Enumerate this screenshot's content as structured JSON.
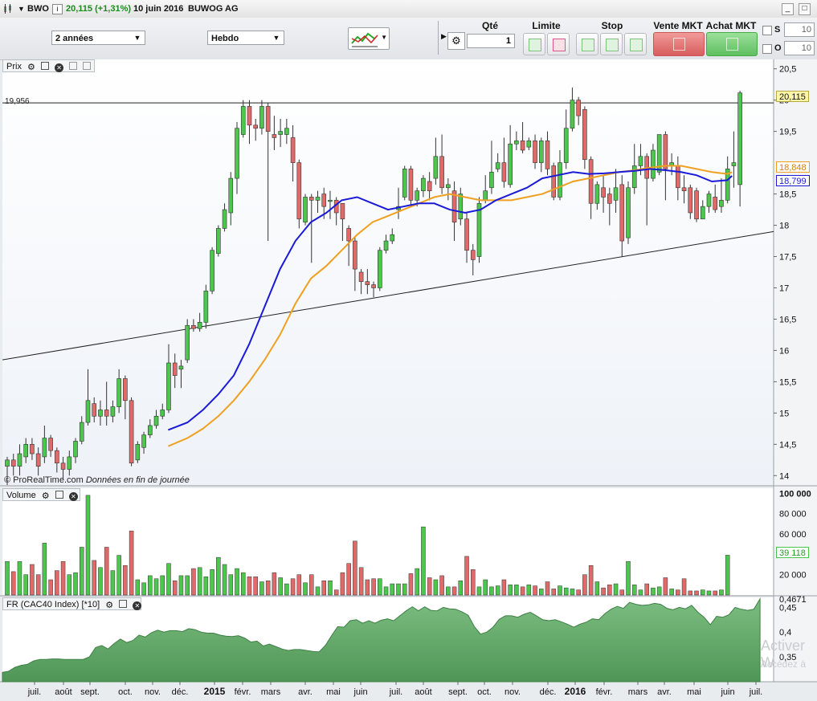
{
  "titlebar": {
    "symbol": "BWO",
    "last": "20,115 (+1,31%)",
    "date": "10 juin 2016",
    "name": "BUWOG AG",
    "min_btn": "_",
    "close_btn": "□"
  },
  "toolbar": {
    "period": "2 années",
    "frequency": "Hebdo",
    "qte_label": "Qté",
    "qte_value": "1",
    "limite_label": "Limite",
    "stop_label": "Stop",
    "vente_label": "Vente MKT",
    "achat_label": "Achat MKT",
    "s_label": "S",
    "s_value": "10",
    "o_label": "O",
    "o_value": "10"
  },
  "panes": {
    "price_label": "Prix",
    "volume_label": "Volume",
    "cac_label": "FR (CAC40 Index) [*10]",
    "credit": "© ProRealTime.com",
    "credit_note": "Données en fin de journée",
    "ref_level": "19,956",
    "watermark": "Activer W",
    "watermark2": "Accédez à"
  },
  "price_axis": {
    "ticks": [
      "20,5",
      "20",
      "19,5",
      "18,5",
      "18",
      "17,5",
      "17",
      "16,5",
      "16",
      "15,5",
      "15",
      "14,5",
      "14"
    ],
    "badge_last": "20,115",
    "badge_ma_orange": "18,848",
    "badge_ma_blue": "18,799"
  },
  "volume_axis": {
    "ticks": [
      "100 000",
      "80 000",
      "60 000",
      "20 000"
    ],
    "badge_last": "39 118"
  },
  "cac_axis": {
    "ticks": [
      "0,4671",
      "0,45",
      "0,4",
      "0,35"
    ]
  },
  "time_axis": {
    "labels": [
      "juil.",
      "août",
      "sept.",
      "oct.",
      "nov.",
      "déc.",
      "2015",
      "févr.",
      "mars",
      "avr.",
      "mai",
      "juin",
      "juil.",
      "août",
      "sept.",
      "oct.",
      "nov.",
      "déc.",
      "2016",
      "févr.",
      "mars",
      "avr.",
      "mai",
      "juin",
      "juil."
    ]
  },
  "colors": {
    "up": "#4cc64c",
    "down": "#e06a6a",
    "ma_blue": "#1a1ad8",
    "ma_orange": "#f0a020",
    "cac_fill": "#6fae75"
  },
  "chart_data": {
    "type": "candlestick",
    "frequency": "weekly",
    "y_range": [
      13.85,
      20.65
    ],
    "reference_level": 19.956,
    "ohlc": [
      [
        14.15,
        14.25,
        13.85,
        14.3
      ],
      [
        14.25,
        14.15,
        14.0,
        14.35
      ],
      [
        14.15,
        14.35,
        14.0,
        14.5
      ],
      [
        14.3,
        14.5,
        14.2,
        14.6
      ],
      [
        14.5,
        14.35,
        14.25,
        14.6
      ],
      [
        14.35,
        14.15,
        14.0,
        14.45
      ],
      [
        14.3,
        14.6,
        14.2,
        14.8
      ],
      [
        14.6,
        14.4,
        14.3,
        14.65
      ],
      [
        14.4,
        14.2,
        14.05,
        14.45
      ],
      [
        14.2,
        14.1,
        13.95,
        14.3
      ],
      [
        14.1,
        14.3,
        14.0,
        14.4
      ],
      [
        14.3,
        14.55,
        14.2,
        14.6
      ],
      [
        14.55,
        14.85,
        14.5,
        14.95
      ],
      [
        14.85,
        15.2,
        14.8,
        15.7
      ],
      [
        15.15,
        14.95,
        14.85,
        15.25
      ],
      [
        14.95,
        15.05,
        14.8,
        15.2
      ],
      [
        15.05,
        14.95,
        14.8,
        15.5
      ],
      [
        14.95,
        15.1,
        14.85,
        15.2
      ],
      [
        15.1,
        15.55,
        15.0,
        15.7
      ],
      [
        15.55,
        15.2,
        14.9,
        15.6
      ],
      [
        15.2,
        14.2,
        14.15,
        15.25
      ],
      [
        14.25,
        14.5,
        14.2,
        14.55
      ],
      [
        14.45,
        14.65,
        14.35,
        14.7
      ],
      [
        14.65,
        14.8,
        14.6,
        14.9
      ],
      [
        14.8,
        14.95,
        14.75,
        15.05
      ],
      [
        14.95,
        15.05,
        14.9,
        15.15
      ],
      [
        15.05,
        15.8,
        15.0,
        16.1
      ],
      [
        15.8,
        15.6,
        15.4,
        15.95
      ],
      [
        15.7,
        15.75,
        15.4,
        15.85
      ],
      [
        15.85,
        16.4,
        15.8,
        16.5
      ],
      [
        16.4,
        16.35,
        16.3,
        16.5
      ],
      [
        16.35,
        16.45,
        16.3,
        16.6
      ],
      [
        16.45,
        16.95,
        16.35,
        17.05
      ],
      [
        16.95,
        17.6,
        16.9,
        17.65
      ],
      [
        17.55,
        17.95,
        17.5,
        18.0
      ],
      [
        17.95,
        18.25,
        17.9,
        18.35
      ],
      [
        18.2,
        18.75,
        18.0,
        18.85
      ],
      [
        18.75,
        19.55,
        18.5,
        19.65
      ],
      [
        19.45,
        19.9,
        19.4,
        20.0
      ],
      [
        19.9,
        19.6,
        19.3,
        20.0
      ],
      [
        19.6,
        19.55,
        19.35,
        19.7
      ],
      [
        19.55,
        19.9,
        19.45,
        20.0
      ],
      [
        19.9,
        19.5,
        17.75,
        19.95
      ],
      [
        19.45,
        19.4,
        19.2,
        19.75
      ],
      [
        19.45,
        19.5,
        19.25,
        19.7
      ],
      [
        19.45,
        19.55,
        19.3,
        19.7
      ],
      [
        19.4,
        19.0,
        18.7,
        19.6
      ],
      [
        19.0,
        18.1,
        17.95,
        19.05
      ],
      [
        18.05,
        18.45,
        18.0,
        18.5
      ],
      [
        18.45,
        18.4,
        17.4,
        18.5
      ],
      [
        18.4,
        18.45,
        18.2,
        18.55
      ],
      [
        18.5,
        18.3,
        18.1,
        18.6
      ],
      [
        18.4,
        18.4,
        18.1,
        18.55
      ],
      [
        18.4,
        18.2,
        18.0,
        18.45
      ],
      [
        18.35,
        18.1,
        17.75,
        18.35
      ],
      [
        17.95,
        17.75,
        17.35,
        18.0
      ],
      [
        17.75,
        17.3,
        16.95,
        17.8
      ],
      [
        17.25,
        17.1,
        16.9,
        17.3
      ],
      [
        17.1,
        17.05,
        16.9,
        17.3
      ],
      [
        17.05,
        17.0,
        16.85,
        17.1
      ],
      [
        17.0,
        17.6,
        16.95,
        17.65
      ],
      [
        17.6,
        17.75,
        17.55,
        17.85
      ],
      [
        17.75,
        17.85,
        17.7,
        17.95
      ],
      [
        18.25,
        18.3,
        18.1,
        18.6
      ],
      [
        18.45,
        18.9,
        18.4,
        18.95
      ],
      [
        18.9,
        18.4,
        18.3,
        18.95
      ],
      [
        18.4,
        18.55,
        18.3,
        18.6
      ],
      [
        18.55,
        18.75,
        18.45,
        18.8
      ],
      [
        18.7,
        18.55,
        18.4,
        18.85
      ],
      [
        18.75,
        19.1,
        18.65,
        19.4
      ],
      [
        19.1,
        18.6,
        18.5,
        19.45
      ],
      [
        18.6,
        18.65,
        18.4,
        18.75
      ],
      [
        18.55,
        18.05,
        17.75,
        18.7
      ],
      [
        18.1,
        18.5,
        18.0,
        18.6
      ],
      [
        18.1,
        17.6,
        17.4,
        18.2
      ],
      [
        17.6,
        17.45,
        17.2,
        17.7
      ],
      [
        17.5,
        18.35,
        17.4,
        18.45
      ],
      [
        18.4,
        18.55,
        18.35,
        18.8
      ],
      [
        18.6,
        18.85,
        18.5,
        19.35
      ],
      [
        18.9,
        19.0,
        18.85,
        19.15
      ],
      [
        19.0,
        18.7,
        18.6,
        19.4
      ],
      [
        18.65,
        19.3,
        18.6,
        19.6
      ],
      [
        19.3,
        19.35,
        19.2,
        19.5
      ],
      [
        19.35,
        19.2,
        19.15,
        19.65
      ],
      [
        19.25,
        19.35,
        19.2,
        19.4
      ],
      [
        19.35,
        19.0,
        18.9,
        19.45
      ],
      [
        19.0,
        19.35,
        18.85,
        19.4
      ],
      [
        19.35,
        18.9,
        18.8,
        19.5
      ],
      [
        18.95,
        18.45,
        18.4,
        19.0
      ],
      [
        18.45,
        19.0,
        18.4,
        19.2
      ],
      [
        19.0,
        19.55,
        18.9,
        19.85
      ],
      [
        19.55,
        20.0,
        19.5,
        20.2
      ],
      [
        20.0,
        19.75,
        19.6,
        20.05
      ],
      [
        19.85,
        19.05,
        18.9,
        19.9
      ],
      [
        19.05,
        18.35,
        18.1,
        19.1
      ],
      [
        18.35,
        18.65,
        18.25,
        18.7
      ],
      [
        18.6,
        18.45,
        18.2,
        18.8
      ],
      [
        18.5,
        18.35,
        18.0,
        18.6
      ],
      [
        18.4,
        18.6,
        18.2,
        18.9
      ],
      [
        18.65,
        17.75,
        17.5,
        18.8
      ],
      [
        17.8,
        18.6,
        17.7,
        18.7
      ],
      [
        18.6,
        18.95,
        18.5,
        19.3
      ],
      [
        18.95,
        19.1,
        18.8,
        19.3
      ],
      [
        19.1,
        18.75,
        18.0,
        19.15
      ],
      [
        18.75,
        19.2,
        18.7,
        19.3
      ],
      [
        18.85,
        19.45,
        18.8,
        19.45
      ],
      [
        19.45,
        18.9,
        18.4,
        19.5
      ],
      [
        18.95,
        19.0,
        18.8,
        19.15
      ],
      [
        18.95,
        18.6,
        18.4,
        19.1
      ],
      [
        18.6,
        18.55,
        18.35,
        18.8
      ],
      [
        18.6,
        18.2,
        18.1,
        18.65
      ],
      [
        18.55,
        18.1,
        18.05,
        18.6
      ],
      [
        18.1,
        18.3,
        18.1,
        18.4
      ],
      [
        18.3,
        18.5,
        18.2,
        18.55
      ],
      [
        18.45,
        18.25,
        18.2,
        18.65
      ],
      [
        18.3,
        18.4,
        18.2,
        18.75
      ],
      [
        18.4,
        18.9,
        18.35,
        19.1
      ],
      [
        18.95,
        19.0,
        18.6,
        19.5
      ],
      [
        18.65,
        20.115,
        18.3,
        20.15
      ]
    ],
    "ma_blue": [
      [
        0.215,
        14.73
      ],
      [
        0.24,
        14.85
      ],
      [
        0.26,
        15.05
      ],
      [
        0.28,
        15.3
      ],
      [
        0.3,
        15.6
      ],
      [
        0.32,
        16.1
      ],
      [
        0.34,
        16.7
      ],
      [
        0.36,
        17.3
      ],
      [
        0.38,
        17.75
      ],
      [
        0.4,
        18.05
      ],
      [
        0.42,
        18.2
      ],
      [
        0.44,
        18.4
      ],
      [
        0.46,
        18.45
      ],
      [
        0.48,
        18.35
      ],
      [
        0.5,
        18.25
      ],
      [
        0.52,
        18.3
      ],
      [
        0.54,
        18.35
      ],
      [
        0.56,
        18.35
      ],
      [
        0.58,
        18.25
      ],
      [
        0.6,
        18.2
      ],
      [
        0.62,
        18.25
      ],
      [
        0.64,
        18.4
      ],
      [
        0.66,
        18.5
      ],
      [
        0.68,
        18.6
      ],
      [
        0.7,
        18.75
      ],
      [
        0.72,
        18.8
      ],
      [
        0.74,
        18.85
      ],
      [
        0.76,
        18.82
      ],
      [
        0.78,
        18.83
      ],
      [
        0.8,
        18.85
      ],
      [
        0.82,
        18.87
      ],
      [
        0.84,
        18.9
      ],
      [
        0.86,
        18.88
      ],
      [
        0.88,
        18.85
      ],
      [
        0.9,
        18.8
      ],
      [
        0.92,
        18.7
      ],
      [
        0.94,
        18.72
      ],
      [
        0.946,
        18.79
      ]
    ],
    "ma_orange": [
      [
        0.215,
        14.47
      ],
      [
        0.24,
        14.6
      ],
      [
        0.26,
        14.75
      ],
      [
        0.28,
        14.95
      ],
      [
        0.3,
        15.2
      ],
      [
        0.32,
        15.5
      ],
      [
        0.34,
        15.85
      ],
      [
        0.36,
        16.25
      ],
      [
        0.38,
        16.75
      ],
      [
        0.4,
        17.15
      ],
      [
        0.42,
        17.35
      ],
      [
        0.44,
        17.6
      ],
      [
        0.46,
        17.85
      ],
      [
        0.48,
        18.05
      ],
      [
        0.5,
        18.15
      ],
      [
        0.52,
        18.25
      ],
      [
        0.54,
        18.35
      ],
      [
        0.56,
        18.45
      ],
      [
        0.58,
        18.5
      ],
      [
        0.6,
        18.45
      ],
      [
        0.62,
        18.4
      ],
      [
        0.64,
        18.4
      ],
      [
        0.66,
        18.4
      ],
      [
        0.68,
        18.45
      ],
      [
        0.7,
        18.5
      ],
      [
        0.72,
        18.6
      ],
      [
        0.74,
        18.7
      ],
      [
        0.76,
        18.75
      ],
      [
        0.78,
        18.8
      ],
      [
        0.8,
        18.85
      ],
      [
        0.82,
        18.88
      ],
      [
        0.84,
        18.92
      ],
      [
        0.86,
        18.95
      ],
      [
        0.88,
        18.95
      ],
      [
        0.9,
        18.9
      ],
      [
        0.92,
        18.85
      ],
      [
        0.94,
        18.82
      ],
      [
        0.946,
        18.848
      ]
    ],
    "trendline": [
      [
        0,
        15.85
      ],
      [
        1,
        17.9
      ]
    ],
    "volume_range": [
      0,
      105000
    ],
    "volume": [
      33000,
      23000,
      33000,
      20000,
      30000,
      20000,
      51000,
      15000,
      24000,
      33000,
      20000,
      22000,
      47000,
      98000,
      34000,
      27000,
      47000,
      24000,
      39000,
      29000,
      63000,
      15000,
      12000,
      19000,
      16000,
      19000,
      31000,
      14000,
      19000,
      19000,
      26000,
      27000,
      18000,
      25000,
      37000,
      30000,
      20000,
      26000,
      22000,
      18000,
      18000,
      13000,
      14000,
      22000,
      17000,
      11000,
      16000,
      20000,
      12000,
      20000,
      8000,
      14000,
      14000,
      5000,
      22000,
      31000,
      53000,
      27000,
      15000,
      16000,
      16000,
      8000,
      11000,
      11000,
      11000,
      21000,
      26000,
      67000,
      17000,
      15000,
      19000,
      8000,
      8000,
      14000,
      38000,
      25000,
      8000,
      15000,
      8000,
      9000,
      15000,
      10000,
      10000,
      8000,
      10000,
      9000,
      6000,
      13000,
      6000,
      9000,
      7000,
      6000,
      5000,
      20000,
      29000,
      13000,
      7000,
      10000,
      11000,
      5000,
      33000,
      10000,
      5000,
      11000,
      7000,
      8000,
      17000,
      6000,
      5000,
      16000,
      4000,
      4000,
      5000,
      4000,
      4000,
      5000,
      39118
    ],
    "cac_range": [
      0.3,
      0.47
    ],
    "cac": [
      0.319,
      0.321,
      0.329,
      0.333,
      0.335,
      0.342,
      0.345,
      0.345,
      0.346,
      0.346,
      0.345,
      0.345,
      0.345,
      0.345,
      0.35,
      0.369,
      0.373,
      0.366,
      0.377,
      0.386,
      0.379,
      0.383,
      0.394,
      0.39,
      0.399,
      0.404,
      0.4,
      0.403,
      0.403,
      0.401,
      0.407,
      0.405,
      0.4,
      0.398,
      0.398,
      0.394,
      0.392,
      0.391,
      0.393,
      0.388,
      0.38,
      0.382,
      0.372,
      0.376,
      0.371,
      0.366,
      0.363,
      0.365,
      0.365,
      0.363,
      0.361,
      0.36,
      0.373,
      0.393,
      0.411,
      0.41,
      0.423,
      0.425,
      0.418,
      0.423,
      0.418,
      0.424,
      0.427,
      0.423,
      0.433,
      0.443,
      0.451,
      0.443,
      0.451,
      0.444,
      0.443,
      0.45,
      0.447,
      0.446,
      0.441,
      0.434,
      0.411,
      0.396,
      0.4,
      0.41,
      0.426,
      0.433,
      0.433,
      0.43,
      0.436,
      0.44,
      0.433,
      0.425,
      0.423,
      0.425,
      0.421,
      0.416,
      0.41,
      0.416,
      0.42,
      0.427,
      0.425,
      0.437,
      0.446,
      0.452,
      0.448,
      0.46,
      0.456,
      0.454,
      0.455,
      0.458,
      0.456,
      0.448,
      0.445,
      0.45,
      0.447,
      0.454,
      0.44,
      0.43,
      0.415,
      0.432,
      0.43,
      0.435,
      0.45,
      0.446,
      0.444,
      0.446,
      0.4671
    ]
  }
}
